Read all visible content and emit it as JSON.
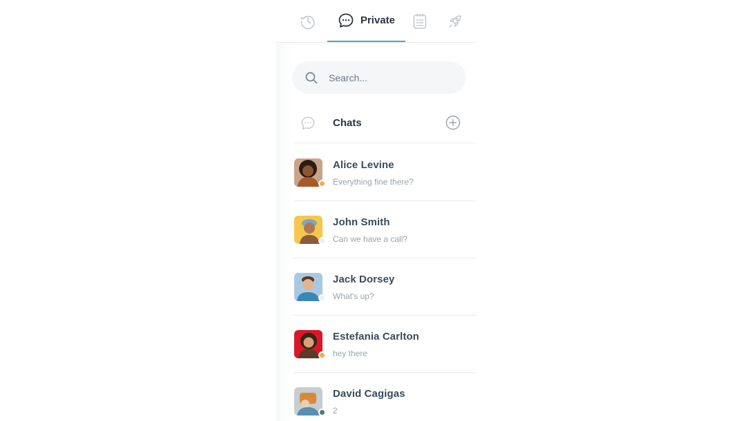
{
  "tabs": {
    "history_icon": "clock-icon",
    "private_label": "Private",
    "private_icon": "chat-bubble-icon",
    "notes_icon": "clipboard-list-icon",
    "rocket_icon": "rocket-icon",
    "active_accent": "#4aa8c2"
  },
  "search": {
    "placeholder": "Search...",
    "icon": "search-icon"
  },
  "chats_section": {
    "title": "Chats",
    "icon": "chat-bubble-icon",
    "add_icon": "plus-circle-icon"
  },
  "chats": [
    {
      "name": "Alice Levine",
      "preview": "Everything fine there?",
      "status_color": "#f0ad4e",
      "avatar_bg": "#c9a48a",
      "avatar_fg": "#a55a2a"
    },
    {
      "name": "John Smith",
      "preview": "Can we have a call?",
      "status_color": "#eeeeee",
      "avatar_bg": "#f5c84c",
      "avatar_fg": "#8c5a3c"
    },
    {
      "name": "Jack Dorsey",
      "preview": "What's up?",
      "status_color": "#eeeeee",
      "avatar_bg": "#a9c9e0",
      "avatar_fg": "#3a87b5"
    },
    {
      "name": "Estefania Carlton",
      "preview": "hey there",
      "status_color": "#f0ad4e",
      "avatar_bg": "#d8182a",
      "avatar_fg": "#5a3a2a"
    },
    {
      "name": "David Cagigas",
      "preview": "2",
      "status_color": "#4f7a7a",
      "avatar_bg": "#c7cdd2",
      "avatar_fg": "#5a8fb0"
    }
  ]
}
